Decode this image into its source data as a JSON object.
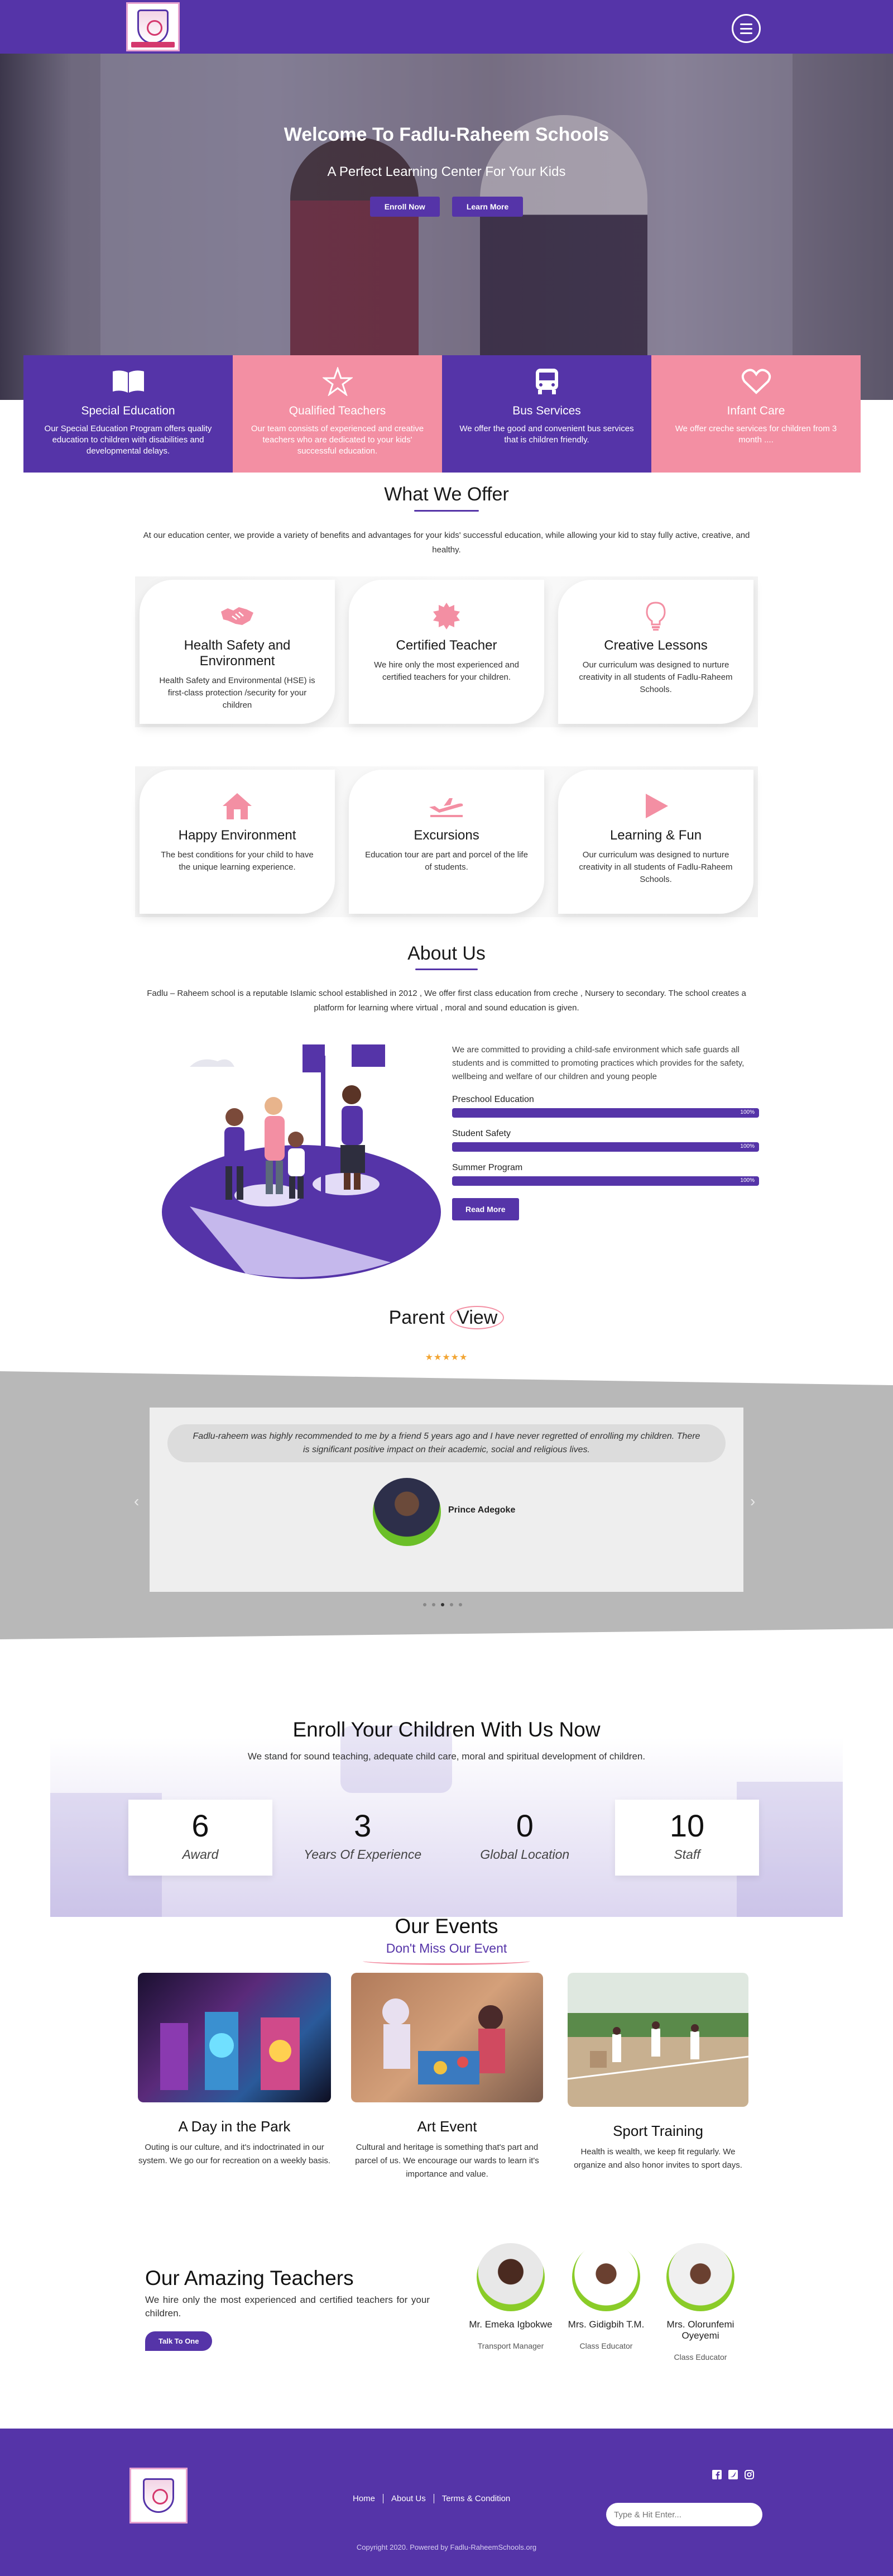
{
  "colors": {
    "accent": "#5534a8",
    "pink": "#f38fa3",
    "star": "#f2a533"
  },
  "header": {
    "menu_icon": "hamburger-icon"
  },
  "hero": {
    "title": "Welcome To Fadlu-Raheem Schools",
    "subtitle": "A Perfect Learning Center For Your Kids",
    "enroll_label": "Enroll Now",
    "learn_label": "Learn More"
  },
  "features": [
    {
      "title": "Special Education",
      "text": "Our Special Education Program offers quality education to children with disabilities and developmental delays.",
      "icon": "book-icon"
    },
    {
      "title": "Qualified Teachers",
      "text": "Our team consists of experienced and creative teachers who are dedicated to your kids' successful education.",
      "icon": "star-icon"
    },
    {
      "title": "Bus Services",
      "text": "We offer the good and convenient bus services that is children friendly.",
      "icon": "bus-icon"
    },
    {
      "title": "Infant Care",
      "text": "We offer creche services for children from 3 month ....",
      "icon": "heart-icon"
    }
  ],
  "offer": {
    "title": "What We Offer",
    "intro": "At our education center, we provide a variety of benefits and advantages for your kids' successful education, while allowing your kid to stay fully active, creative, and healthy.",
    "cards": [
      {
        "title": "Health Safety and Environment",
        "text": "Health Safety and Environmental (HSE) is first-class protection /security for your children",
        "icon": "handshake-icon"
      },
      {
        "title": "Certified Teacher",
        "text": "We hire only the most experienced and certified teachers for your children.",
        "icon": "badge-icon"
      },
      {
        "title": "Creative Lessons",
        "text": "Our curriculum was designed to nurture creativity in all students of Fadlu-Raheem Schools.",
        "icon": "lightbulb-icon"
      },
      {
        "title": "Happy Environment",
        "text": "The best conditions for your child to have the unique learning experience.",
        "icon": "home-icon"
      },
      {
        "title": "Excursions",
        "text": "Education tour are part and porcel of the life of students.",
        "icon": "plane-icon"
      },
      {
        "title": "Learning & Fun",
        "text": "Our curriculum was designed to nurture creativity in all students of Fadlu-Raheem Schools.",
        "icon": "play-icon"
      }
    ]
  },
  "about": {
    "title": "About Us",
    "intro": "Fadlu – Raheem school is a reputable Islamic school established in 2012 , We offer first class education from creche , Nursery to secondary. The school creates a platform for learning where virtual , moral and sound education is given.",
    "text": "We are committed to providing a child-safe environment which safe guards all students and is committed to promoting practices which provides for the safety, wellbeing and welfare of our children and young people",
    "skills": [
      {
        "label": "Preschool Education",
        "value": "100%",
        "level": 1.0
      },
      {
        "label": "Student Safety",
        "value": "100%",
        "level": 1.0
      },
      {
        "label": "Summer Program",
        "value": "100%",
        "level": 1.0
      }
    ],
    "read_more": "Read More"
  },
  "parents": {
    "title_a": "Parent",
    "title_b": "View",
    "stars": "★★★★★",
    "quote": "Fadlu-raheem was highly recommended to me by a friend 5 years ago and I have never regretted of enrolling my children. There is significant positive impact on their academic, social and religious lives.",
    "name": "Prince Adegoke",
    "prev": "‹",
    "next": "›"
  },
  "enroll": {
    "title": "Enroll Your Children With Us Now",
    "subtitle": "We stand for sound teaching, adequate child care, moral and spiritual development of children.",
    "stats": [
      {
        "num": "6",
        "label": "Award"
      },
      {
        "num": "3",
        "label": "Years Of Experience"
      },
      {
        "num": "0",
        "label": "Global Location"
      },
      {
        "num": "10",
        "label": "Staff"
      }
    ]
  },
  "events": {
    "title": "Our Events",
    "subtitle": "Don't Miss Our Event",
    "items": [
      {
        "title": "A Day in the Park",
        "text": "Outing is our culture, and it's indoctrinated in our system. We go our for recreation on a weekly basis."
      },
      {
        "title": "Art Event",
        "text": "Cultural and heritage is something that's part and parcel of us. We encourage our wards to learn it's importance and value."
      },
      {
        "title": "Sport Training",
        "text": "Health is wealth, we keep fit regularly. We organize and also honor invites to sport days."
      }
    ]
  },
  "teachers": {
    "title": "Our Amazing Teachers",
    "text": "We hire only the most experienced and certified teachers for your children.",
    "cta": "Talk To One",
    "people": [
      {
        "name": "Mr. Emeka Igbokwe",
        "role": "Transport Manager"
      },
      {
        "name": "Mrs. Gidigbih T.M.",
        "role": "Class Educator"
      },
      {
        "name": "Mrs. Olorunfemi Oyeyemi",
        "role": "Class Educator"
      }
    ]
  },
  "footer": {
    "links": [
      "Home",
      "About Us",
      "Terms & Condition"
    ],
    "search_placeholder": "Type & Hit Enter...",
    "copyright": "Copyright 2020. Powered by Fadlu-RaheemSchools.org",
    "socials": [
      "facebook-icon",
      "twitter-icon",
      "instagram-icon"
    ]
  }
}
